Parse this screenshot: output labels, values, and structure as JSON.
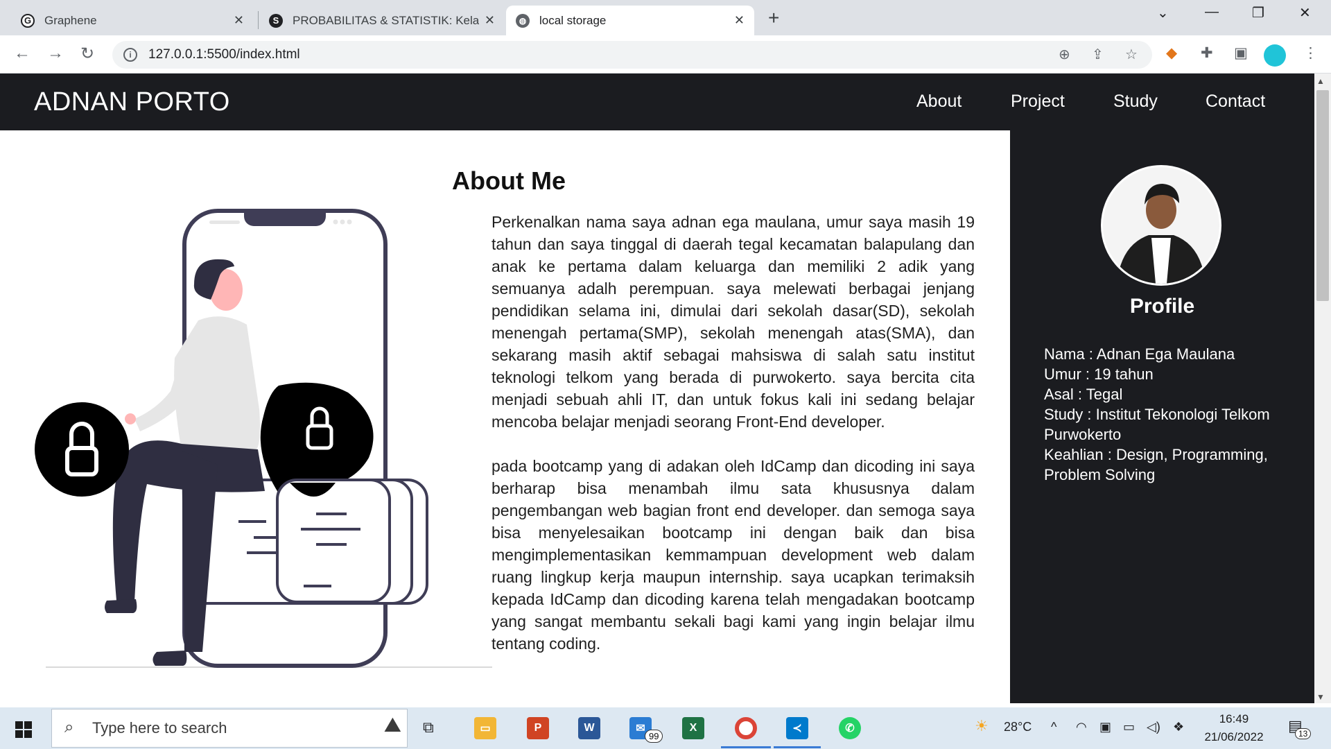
{
  "browser": {
    "tabs": [
      {
        "title": "Graphene",
        "favicon": "G"
      },
      {
        "title": "PROBABILITAS & STATISTIK: Kela",
        "favicon": "S"
      },
      {
        "title": "local storage",
        "favicon": "globe"
      }
    ],
    "url": "127.0.0.1:5500/index.html"
  },
  "site": {
    "brand": "ADNAN PORTO",
    "menu": [
      "About",
      "Project",
      "Study",
      "Contact"
    ],
    "about": {
      "title": "About Me",
      "paragraph1": "Perkenalkan nama saya adnan ega maulana, umur saya masih 19 tahun dan saya tinggal di daerah tegal kecamatan balapulang dan anak ke pertama dalam keluarga dan memiliki 2 adik yang semuanya adalh perempuan. saya melewati berbagai jenjang pendidikan selama ini, dimulai dari sekolah dasar(SD), sekolah menengah pertama(SMP), sekolah menengah atas(SMA), dan sekarang masih aktif sebagai mahsiswa di salah satu institut teknologi telkom yang berada di purwokerto. saya bercita cita menjadi sebuah ahli IT, dan untuk fokus kali ini sedang belajar mencoba belajar menjadi seorang Front-End developer.",
      "paragraph2": "pada bootcamp yang di adakan oleh IdCamp dan dicoding ini saya berharap bisa menambah ilmu sata khususnya dalam pengembangan web bagian front end developer. dan semoga saya bisa menyelesaikan bootcamp ini dengan baik dan bisa mengimplementasikan kemmampuan development web dalam ruang lingkup kerja maupun internship. saya ucapkan terimaksih kepada IdCamp dan dicoding karena telah mengadakan bootcamp yang sangat membantu sekali bagi kami yang ingin belajar ilmu tentang coding."
    },
    "profile": {
      "title": "Profile",
      "lines": [
        "Nama : Adnan Ega Maulana",
        "Umur : 19 tahun",
        "Asal : Tegal",
        "Study : Institut Tekonologi Telkom Purwokerto",
        "Keahlian : Design, Programming, Problem Solving"
      ]
    }
  },
  "taskbar": {
    "search_placeholder": "Type here to search",
    "weather": "28°C",
    "time": "16:49",
    "date": "21/06/2022",
    "mail_badge": "99",
    "notification_count": "13"
  },
  "colors": {
    "nav_bg": "#1b1c20",
    "accent": "#3f3d56",
    "skin": "#ffb6b6"
  }
}
